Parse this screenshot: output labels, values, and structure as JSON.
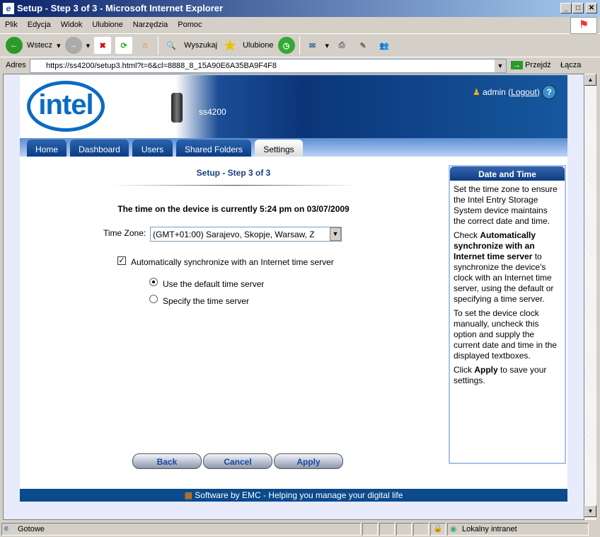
{
  "window": {
    "title": "Setup - Step 3 of 3 - Microsoft Internet Explorer"
  },
  "menu": [
    "Plik",
    "Edycja",
    "Widok",
    "Ulubione",
    "Narzędzia",
    "Pomoc"
  ],
  "toolbar": {
    "back": "Wstecz",
    "search": "Wyszukaj",
    "favorites": "Ulubione"
  },
  "address": {
    "label": "Adres",
    "url": "https://ss4200/setup3.html?t=6&cl=8888_8_15A90E6A35BA9F4F8",
    "go": "Przejdź",
    "links": "Łącza"
  },
  "header": {
    "logo": "intel",
    "device": "ss4200",
    "user": "admin",
    "logout": "Logout"
  },
  "tabs": [
    "Home",
    "Dashboard",
    "Users",
    "Shared Folders",
    "Settings"
  ],
  "active_tab": "Settings",
  "main": {
    "title": "Setup - Step 3 of 3",
    "time_text": "The time on the device is currently 5:24 pm on 03/07/2009",
    "tz_label": "Time Zone:",
    "tz_value": "(GMT+01:00) Sarajevo, Skopje, Warsaw, Z",
    "auto_sync": "Automatically synchronize with an Internet time server",
    "auto_sync_checked": true,
    "radio_default": "Use the default time server",
    "radio_specify": "Specify the time server",
    "selected_radio": "default"
  },
  "buttons": {
    "back": "Back",
    "cancel": "Cancel",
    "apply": "Apply"
  },
  "help": {
    "title": "Date and Time",
    "p1": "Set the time zone to ensure the Intel Entry Storage System device maintains the correct date and time.",
    "p2a": "Check ",
    "p2b": "Automatically synchronize with an Internet time server",
    "p2c": " to synchronize the device's clock with an Internet time server, using the default or specifying a time server.",
    "p3": "To set the device clock manually, uncheck this option and supply the current date and time in the displayed textboxes.",
    "p4a": "Click ",
    "p4b": "Apply",
    "p4c": " to save your settings."
  },
  "footer": "Software by EMC - Helping you manage your digital life",
  "status": {
    "text": "Gotowe",
    "zone": "Lokalny intranet"
  }
}
